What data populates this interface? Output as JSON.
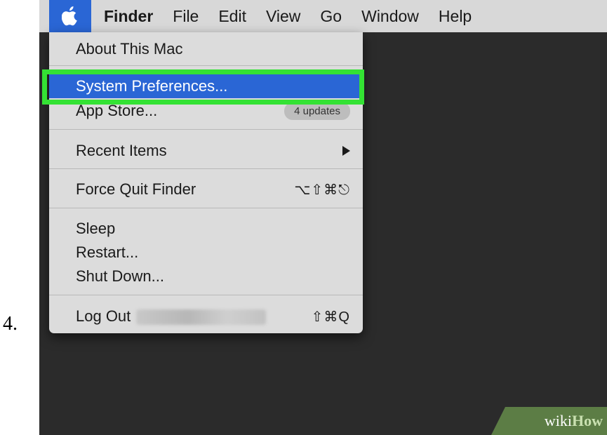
{
  "step": {
    "number": "4."
  },
  "menubar": {
    "apple_icon": "apple-logo-icon",
    "items": [
      "Finder",
      "File",
      "Edit",
      "View",
      "Go",
      "Window",
      "Help"
    ]
  },
  "dropdown": {
    "about": "About This Mac",
    "system_preferences": "System Preferences...",
    "app_store": "App Store...",
    "app_store_badge": "4 updates",
    "recent_items": "Recent Items",
    "force_quit": "Force Quit Finder",
    "force_quit_shortcut": "⌥⇧⌘⎋",
    "sleep": "Sleep",
    "restart": "Restart...",
    "shut_down": "Shut Down...",
    "log_out": "Log Out",
    "log_out_shortcut": "⇧⌘Q"
  },
  "watermark": {
    "wiki": "wiki",
    "how": "How"
  },
  "colors": {
    "highlight": "#2a66d5",
    "annotation_box": "#34e234",
    "watermark_bg": "#5c7d45"
  }
}
